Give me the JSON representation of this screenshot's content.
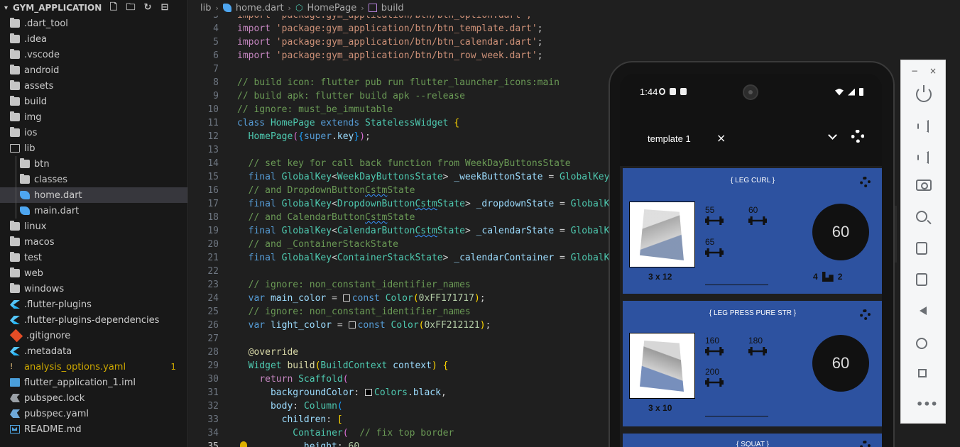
{
  "explorer": {
    "title": "GYM_APPLICATION",
    "items": [
      {
        "label": ".dart_tool",
        "type": "folder"
      },
      {
        "label": ".idea",
        "type": "folder"
      },
      {
        "label": ".vscode",
        "type": "folder"
      },
      {
        "label": "android",
        "type": "folder"
      },
      {
        "label": "assets",
        "type": "folder"
      },
      {
        "label": "build",
        "type": "folder"
      },
      {
        "label": "img",
        "type": "folder"
      },
      {
        "label": "ios",
        "type": "folder"
      },
      {
        "label": "lib",
        "type": "folder-open"
      },
      {
        "label": "btn",
        "type": "folder"
      },
      {
        "label": "classes",
        "type": "folder"
      },
      {
        "label": "home.dart",
        "type": "dart"
      },
      {
        "label": "main.dart",
        "type": "dart"
      },
      {
        "label": "linux",
        "type": "folder"
      },
      {
        "label": "macos",
        "type": "folder"
      },
      {
        "label": "test",
        "type": "folder"
      },
      {
        "label": "web",
        "type": "folder"
      },
      {
        "label": "windows",
        "type": "folder"
      },
      {
        "label": ".flutter-plugins",
        "type": "flutter"
      },
      {
        "label": ".flutter-plugins-dependencies",
        "type": "flutter"
      },
      {
        "label": ".gitignore",
        "type": "git"
      },
      {
        "label": ".metadata",
        "type": "flutter"
      },
      {
        "label": "analysis_options.yaml",
        "type": "yaml",
        "badge": "1"
      },
      {
        "label": "flutter_application_1.iml",
        "type": "iml"
      },
      {
        "label": "pubspec.lock",
        "type": "lock"
      },
      {
        "label": "pubspec.yaml",
        "type": "pub"
      },
      {
        "label": "README.md",
        "type": "md"
      }
    ]
  },
  "breadcrumb": [
    "lib",
    "home.dart",
    "HomePage",
    "build"
  ],
  "line_numbers": [
    "3",
    "4",
    "5",
    "6",
    "7",
    "8",
    "9",
    "10",
    "11",
    "12",
    "13",
    "14",
    "15",
    "16",
    "17",
    "18",
    "19",
    "20",
    "21",
    "22",
    "23",
    "24",
    "25",
    "26",
    "27",
    "28",
    "29",
    "30",
    "31",
    "32",
    "33",
    "34",
    "35"
  ],
  "code": {
    "l3": "import 'package:gym_application/btn/btn_option.dart';",
    "l4a": "import",
    "l4b": "'package:gym_application/btn/btn_template.dart'",
    "l5a": "import",
    "l5b": "'package:gym_application/btn/btn_calendar.dart'",
    "l6a": "import",
    "l6b": "'package:gym_application/btn/btn_row_week.dart'",
    "l8": "// build icon: flutter pub run flutter_launcher_icons:main",
    "l9": "// build apk: flutter build apk --release",
    "l10": "// ignore: must_be_immutable",
    "l11": [
      "class",
      "HomePage",
      "extends",
      "StatelessWidget",
      "{"
    ],
    "l12": [
      "HomePage",
      "(",
      "{",
      "super",
      ".",
      "key",
      "}",
      ")",
      ";"
    ],
    "l14": "// set key for call back function from WeekDayButtonsState",
    "l15": [
      "final",
      "GlobalKey",
      "<",
      "WeekDayButtonsState",
      ">",
      "_weekButtonState",
      "=",
      "GlobalKey<"
    ],
    "l16a": "// and DropdownButton",
    "l16b": "Cstm",
    "l16c": "State",
    "l17": [
      "final",
      "GlobalKey",
      "<",
      "DropdownButton",
      "Cstm",
      "State",
      ">",
      "_dropdownState",
      "=",
      "GlobalKe"
    ],
    "l18a": "// and CalendarButton",
    "l18b": "Cstm",
    "l18c": "State",
    "l19": [
      "final",
      "GlobalKey",
      "<",
      "CalendarButton",
      "Cstm",
      "State",
      ">",
      "_calendarState",
      "=",
      "GlobalKe"
    ],
    "l20": "// and _ContainerStackState",
    "l21": [
      "final",
      "GlobalKey",
      "<",
      "ContainerStackState",
      ">",
      "_calendarContainer",
      "=",
      "GlobalKe"
    ],
    "l23": "// ignore: non_constant_identifier_names",
    "l24": [
      "var",
      "main_color",
      "=",
      "const",
      "Color",
      "(",
      "0xFF171717",
      ")",
      ";"
    ],
    "l25": "// ignore: non_constant_identifier_names",
    "l26": [
      "var",
      "light_color",
      "=",
      "const",
      "Color",
      "(",
      "0xFF212121",
      ")",
      ";"
    ],
    "l28": "@override",
    "l29": [
      "Widget",
      "build",
      "(",
      "BuildContext",
      "context",
      ")",
      "{"
    ],
    "l30": [
      "return",
      "Scaffold",
      "("
    ],
    "l31": [
      "backgroundColor",
      ":",
      "Colors",
      ".",
      "black",
      ","
    ],
    "l32": [
      "body",
      ":",
      "Column",
      "("
    ],
    "l33": [
      "children",
      ":",
      "["
    ],
    "l34": [
      "Container",
      "(",
      "// fix top border"
    ],
    "l35": [
      "height",
      ":",
      "60"
    ]
  },
  "phone": {
    "time": "1:44",
    "template_value": "template 1",
    "close_glyph": "×",
    "cards": [
      {
        "title": "{ LEG CURL }",
        "sets": "3 x 12",
        "weights": [
          "55",
          "60",
          "65"
        ],
        "timer": "60",
        "rest_a": "4",
        "rest_b": "2",
        "thumb": "leg-curl-illustration"
      },
      {
        "title": "{ LEG PRESS PURE STR }",
        "sets": "3 x 10",
        "weights": [
          "160",
          "180",
          "200"
        ],
        "timer": "60",
        "thumb": "leg-press-illustration"
      },
      {
        "title": "{ SQUAT }"
      }
    ]
  },
  "emulator_toolbar": {
    "minimize": "−",
    "close": "×",
    "more": "•••"
  },
  "colors": {
    "card_blue": "#2d52a0",
    "app_bg": "#1e1e1e",
    "editor_bg": "#1f1f1f",
    "explorer_bg": "#181818"
  }
}
